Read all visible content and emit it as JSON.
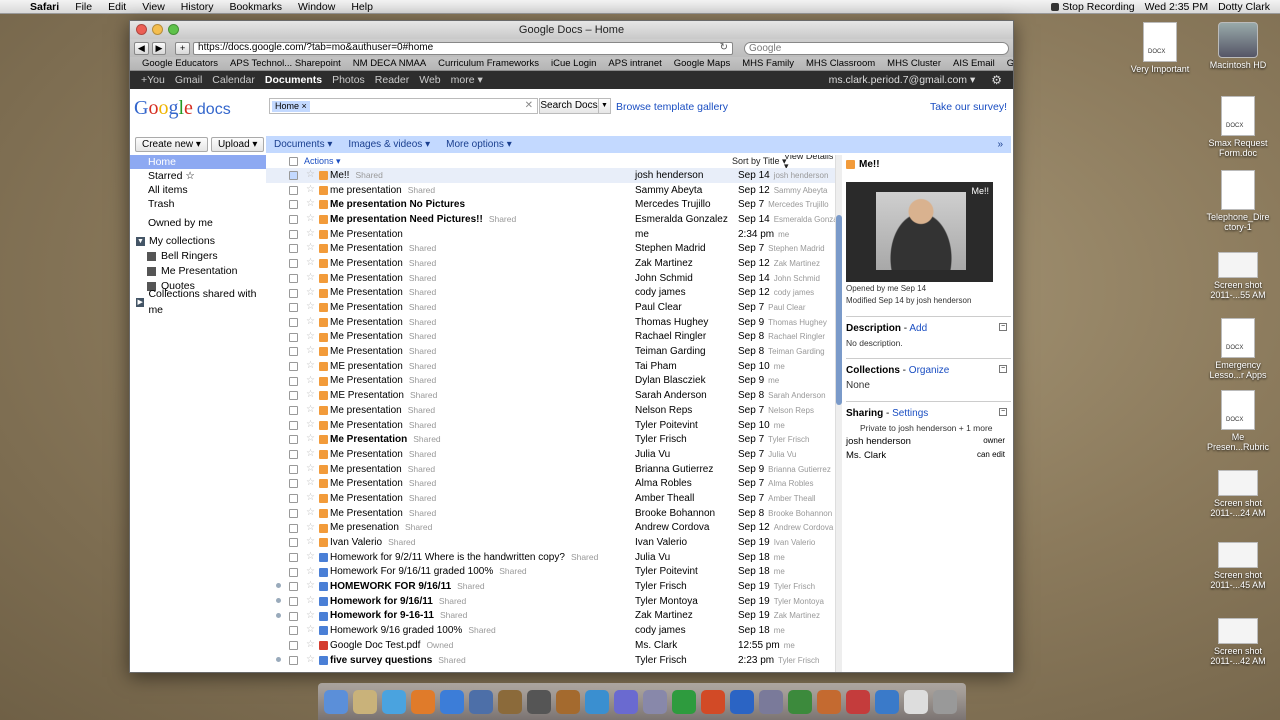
{
  "menubar": {
    "app": "Safari",
    "items": [
      "File",
      "Edit",
      "View",
      "History",
      "Bookmarks",
      "Window",
      "Help"
    ],
    "recording": "Stop Recording",
    "clock": "Wed 2:35 PM",
    "user": "Dotty Clark"
  },
  "window": {
    "title": "Google Docs – Home",
    "url": "https://docs.google.com/?tab=mo&authuser=0#home",
    "search_placeholder": "Google",
    "bookmarks": [
      "Google Educators",
      "APS Technol... Sharepoint",
      "NM DECA NMAA",
      "Curriculum Frameworks",
      "iCue Login",
      "APS intranet",
      "Google Maps",
      "MHS Family",
      "MHS Classroom",
      "MHS Cluster",
      "AIS Email",
      "Gmail"
    ]
  },
  "gbar": {
    "items": [
      "+You",
      "Gmail",
      "Calendar",
      "Documents",
      "Photos",
      "Reader",
      "Web",
      "more ▾"
    ],
    "account": "ms.clark.period.7@gmail.com ▾"
  },
  "header": {
    "logo_google": "Google",
    "logo_docs": "docs",
    "chip": "Home ×",
    "search_button": "Search Docs",
    "template_link": "Browse template gallery",
    "survey_link": "Take our survey!"
  },
  "buttons": {
    "create": "Create new ▾",
    "upload": "Upload ▾"
  },
  "toolbar": {
    "documents": "Documents ▾",
    "images": "Images & videos ▾",
    "more": "More options ▾"
  },
  "sidebar": {
    "home": "Home",
    "starred": "Starred ☆",
    "all": "All items",
    "trash": "Trash",
    "owned": "Owned by me",
    "mycollections": "My collections",
    "collections": [
      "Bell Ringers",
      "Me Presentation",
      "Quotes"
    ],
    "shared": "Collections shared with me"
  },
  "list": {
    "actions": "Actions ▾",
    "sort": "Sort by Title ▾",
    "view": "View Details ▾",
    "rows": [
      {
        "title": "Me!!",
        "shared": "Shared",
        "owner": "josh henderson",
        "date": "Sep 14",
        "by": "josh henderson",
        "type": "pres",
        "bold": false,
        "sel": true
      },
      {
        "title": "me presentation",
        "shared": "Shared",
        "owner": "Sammy Abeyta",
        "date": "Sep 12",
        "by": "Sammy Abeyta",
        "type": "pres",
        "bold": false
      },
      {
        "title": "Me presentation No Pictures",
        "shared": "",
        "owner": "Mercedes Trujillo",
        "date": "Sep 7",
        "by": "Mercedes Trujillo",
        "type": "pres",
        "bold": true
      },
      {
        "title": "Me presentation Need Pictures!!",
        "shared": "Shared",
        "owner": "Esmeralda Gonzalez",
        "date": "Sep 14",
        "by": "Esmeralda Gonzalez",
        "type": "pres",
        "bold": true
      },
      {
        "title": "Me Presentation",
        "shared": "",
        "owner": "me",
        "date": "2:34 pm",
        "by": "me",
        "type": "pres",
        "bold": false
      },
      {
        "title": "Me Presentation",
        "shared": "Shared",
        "owner": "Stephen Madrid",
        "date": "Sep 7",
        "by": "Stephen Madrid",
        "type": "pres",
        "bold": false
      },
      {
        "title": "Me Presentation",
        "shared": "Shared",
        "owner": "Zak Martinez",
        "date": "Sep 12",
        "by": "Zak Martinez",
        "type": "pres",
        "bold": false
      },
      {
        "title": "Me Presentation",
        "shared": "Shared",
        "owner": "John Schmid",
        "date": "Sep 14",
        "by": "John Schmid",
        "type": "pres",
        "bold": false
      },
      {
        "title": "Me Presentation",
        "shared": "Shared",
        "owner": "cody james",
        "date": "Sep 12",
        "by": "cody james",
        "type": "pres",
        "bold": false
      },
      {
        "title": "Me Presentation",
        "shared": "Shared",
        "owner": "Paul Clear",
        "date": "Sep 7",
        "by": "Paul Clear",
        "type": "pres",
        "bold": false
      },
      {
        "title": "Me Presentation",
        "shared": "Shared",
        "owner": "Thomas Hughey",
        "date": "Sep 9",
        "by": "Thomas Hughey",
        "type": "pres",
        "bold": false
      },
      {
        "title": "Me Presentation",
        "shared": "Shared",
        "owner": "Rachael Ringler",
        "date": "Sep 8",
        "by": "Rachael Ringler",
        "type": "pres",
        "bold": false
      },
      {
        "title": "Me Presentation",
        "shared": "Shared",
        "owner": "Teiman Garding",
        "date": "Sep 8",
        "by": "Teiman Garding",
        "type": "pres",
        "bold": false
      },
      {
        "title": "ME presentation",
        "shared": "Shared",
        "owner": "Tai Pham",
        "date": "Sep 10",
        "by": "me",
        "type": "pres",
        "bold": false
      },
      {
        "title": "Me Presentation",
        "shared": "Shared",
        "owner": "Dylan Blascziek",
        "date": "Sep 9",
        "by": "me",
        "type": "pres",
        "bold": false
      },
      {
        "title": "ME Presentation",
        "shared": "Shared",
        "owner": "Sarah Anderson",
        "date": "Sep 8",
        "by": "Sarah Anderson",
        "type": "pres",
        "bold": false
      },
      {
        "title": "Me presentation",
        "shared": "Shared",
        "owner": "Nelson Reps",
        "date": "Sep 7",
        "by": "Nelson Reps",
        "type": "pres",
        "bold": false
      },
      {
        "title": "Me Presentation",
        "shared": "Shared",
        "owner": "Tyler Poitevint",
        "date": "Sep 10",
        "by": "me",
        "type": "pres",
        "bold": false
      },
      {
        "title": "Me Presentation",
        "shared": "Shared",
        "owner": "Tyler Frisch",
        "date": "Sep 7",
        "by": "Tyler Frisch",
        "type": "pres",
        "bold": true
      },
      {
        "title": "Me Presentation",
        "shared": "Shared",
        "owner": "Julia Vu",
        "date": "Sep 7",
        "by": "Julia Vu",
        "type": "pres",
        "bold": false
      },
      {
        "title": "Me presentation",
        "shared": "Shared",
        "owner": "Brianna Gutierrez",
        "date": "Sep 9",
        "by": "Brianna Gutierrez",
        "type": "pres",
        "bold": false
      },
      {
        "title": "Me Presentation",
        "shared": "Shared",
        "owner": "Alma Robles",
        "date": "Sep 7",
        "by": "Alma Robles",
        "type": "pres",
        "bold": false
      },
      {
        "title": "Me Presentation",
        "shared": "Shared",
        "owner": "Amber Theall",
        "date": "Sep 7",
        "by": "Amber Theall",
        "type": "pres",
        "bold": false
      },
      {
        "title": "Me Presentation",
        "shared": "Shared",
        "owner": "Brooke Bohannon",
        "date": "Sep 8",
        "by": "Brooke Bohannon",
        "type": "pres",
        "bold": false
      },
      {
        "title": "Me presenation",
        "shared": "Shared",
        "owner": "Andrew Cordova",
        "date": "Sep 12",
        "by": "Andrew Cordova",
        "type": "pres",
        "bold": false
      },
      {
        "title": "Ivan Valerio",
        "shared": "Shared",
        "owner": "Ivan Valerio",
        "date": "Sep 19",
        "by": "Ivan Valerio",
        "type": "pres",
        "bold": false
      },
      {
        "title": "Homework for 9/2/11 Where is the handwritten copy?",
        "shared": "Shared",
        "owner": "Julia Vu",
        "date": "Sep 18",
        "by": "me",
        "type": "doc",
        "bold": false
      },
      {
        "title": "Homework For 9/16/11 graded 100%",
        "shared": "Shared",
        "owner": "Tyler Poitevint",
        "date": "Sep 18",
        "by": "me",
        "type": "doc",
        "bold": false
      },
      {
        "title": "HOMEWORK FOR 9/16/11",
        "shared": "Shared",
        "owner": "Tyler Frisch",
        "date": "Sep 19",
        "by": "Tyler Frisch",
        "type": "doc",
        "bold": true,
        "dot": true
      },
      {
        "title": "Homework for 9/16/11",
        "shared": "Shared",
        "owner": "Tyler Montoya",
        "date": "Sep 19",
        "by": "Tyler Montoya",
        "type": "doc",
        "bold": true,
        "dot": true
      },
      {
        "title": "Homework for 9-16-11",
        "shared": "Shared",
        "owner": "Zak Martinez",
        "date": "Sep 19",
        "by": "Zak Martinez",
        "type": "doc",
        "bold": true,
        "dot": true
      },
      {
        "title": "Homework 9/16 graded 100%",
        "shared": "Shared",
        "owner": "cody james",
        "date": "Sep 18",
        "by": "me",
        "type": "doc",
        "bold": false
      },
      {
        "title": "Google Doc Test.pdf",
        "shared": "Owned",
        "owner": "Ms. Clark",
        "date": "12:55 pm",
        "by": "me",
        "type": "pdf",
        "bold": false
      },
      {
        "title": "five survey questions",
        "shared": "Shared",
        "owner": "Tyler Frisch",
        "date": "2:23 pm",
        "by": "Tyler Frisch",
        "type": "doc",
        "bold": true,
        "dot": true
      }
    ]
  },
  "preview": {
    "title": "Me!!",
    "thumb_caption": "Me!!",
    "opened": "Opened by me Sep 14",
    "modified": "Modified Sep 14 by josh henderson",
    "desc_label": "Description",
    "desc_link": "Add",
    "desc_text": "No description.",
    "coll_label": "Collections",
    "coll_link": "Organize",
    "coll_text": "None",
    "share_label": "Sharing",
    "share_link": "Settings",
    "share_text": "Private to josh henderson + 1 more",
    "share_people": [
      {
        "name": "josh henderson",
        "role": "owner"
      },
      {
        "name": "Ms. Clark",
        "role": "can edit"
      }
    ]
  },
  "desktop": {
    "icons": [
      {
        "label": "Very Important",
        "kind": "docx"
      },
      {
        "label": "Macintosh HD",
        "kind": "hd"
      },
      {
        "label": "Smax Request Form.doc",
        "kind": "docx"
      },
      {
        "label": "Telephone_Dire ctory-1",
        "kind": "docx"
      },
      {
        "label": "Screen shot 2011-...55 AM",
        "kind": "shot"
      },
      {
        "label": "Emergency Lesso...r Apps",
        "kind": "docx"
      },
      {
        "label": "Me Presen...Rubric",
        "kind": "docx"
      },
      {
        "label": "Screen shot 2011-...24 AM",
        "kind": "shot"
      },
      {
        "label": "Screen shot 2011-...45 AM",
        "kind": "shot"
      },
      {
        "label": "Screen shot 2011-...42 AM",
        "kind": "shot"
      }
    ]
  }
}
